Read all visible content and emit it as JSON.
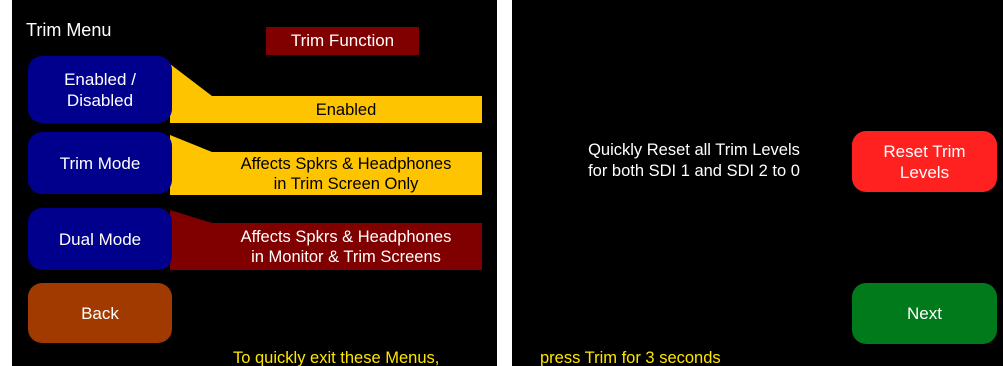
{
  "left_screen": {
    "title": "Trim Menu",
    "header_label": "Trim Function",
    "buttons": {
      "enabled_disabled": {
        "line1": "Enabled /",
        "line2": "Disabled"
      },
      "trim_mode": {
        "label": "Trim Mode"
      },
      "dual_mode": {
        "label": "Dual Mode"
      },
      "back": {
        "label": "Back"
      }
    },
    "values": {
      "enabled": "Enabled",
      "trim_mode": {
        "line1": "Affects Spkrs & Headphones",
        "line2": "in Trim Screen Only"
      },
      "dual_mode": {
        "line1": "Affects Spkrs & Headphones",
        "line2": "in Monitor & Trim Screens"
      }
    },
    "footer_note": "To quickly exit these Menus,"
  },
  "right_screen": {
    "reset_info": {
      "line1": "Quickly Reset all Trim Levels",
      "line2": "for both SDI 1 and SDI 2 to 0"
    },
    "buttons": {
      "reset_trim": {
        "line1": "Reset Trim",
        "line2": "Levels"
      },
      "next": {
        "label": "Next"
      }
    },
    "footer_note": "press Trim for 3 seconds"
  },
  "colors": {
    "background": "#000000",
    "blue_button": "#00008c",
    "brown_button": "#a03a00",
    "red_button": "#ff2020",
    "green_button": "#007a1a",
    "yellow_box": "#ffc400",
    "maroon_box": "#800000",
    "note_text": "#ffe600"
  }
}
